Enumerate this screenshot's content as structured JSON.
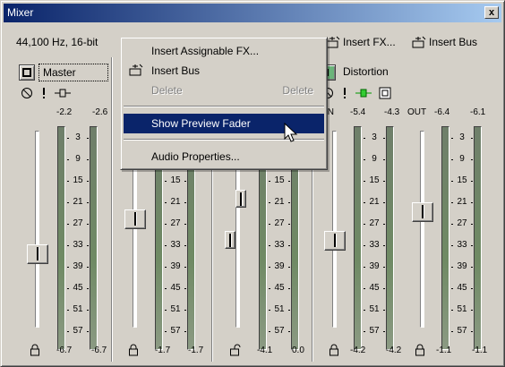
{
  "window": {
    "title": "Mixer",
    "close_glyph": "x"
  },
  "toolbar": {
    "format": "44,100 Hz, 16-bit",
    "insert_fx": "Insert FX...",
    "insert_bus": "Insert Bus"
  },
  "menu": {
    "items": [
      {
        "label": "Insert Assignable FX...",
        "shortcut": ""
      },
      {
        "label": "Insert Bus",
        "shortcut": ""
      },
      {
        "label": "Delete",
        "shortcut": "Delete"
      },
      {
        "label": "Show Preview Fader",
        "shortcut": ""
      },
      {
        "label": "Audio Properties...",
        "shortcut": ""
      }
    ]
  },
  "strips": [
    {
      "name": "Master",
      "peaks": [
        "-2.2",
        "-2.6"
      ],
      "bottom": [
        "-6.7",
        "-6.7"
      ],
      "scale": [
        "3",
        "9",
        "15",
        "21",
        "27",
        "33",
        "39",
        "45",
        "51",
        "57"
      ]
    },
    {
      "name": "",
      "peaks": [
        "",
        ""
      ],
      "bottom": [
        "-1.7",
        "-1.7"
      ],
      "scale": [
        "15",
        "21",
        "27",
        "33",
        "39",
        "45",
        "51",
        "57"
      ]
    },
    {
      "name": "",
      "peaks": [
        "",
        ""
      ],
      "bottom": [
        "-4.1",
        "0.0"
      ],
      "scale": [
        "15",
        "21",
        "27",
        "33",
        "39",
        "45",
        "51",
        "57"
      ]
    },
    {
      "name": "Distortion",
      "peaks": [
        "IN",
        "-5.4",
        "-4.3",
        "OUT",
        "-6.4",
        "-6.1"
      ],
      "bottom": [
        "-4.2",
        "-4.2",
        "-1.1",
        "-1.1"
      ],
      "scale": [
        "3",
        "9",
        "15",
        "21",
        "27",
        "33",
        "39",
        "45",
        "51",
        "57"
      ]
    }
  ]
}
